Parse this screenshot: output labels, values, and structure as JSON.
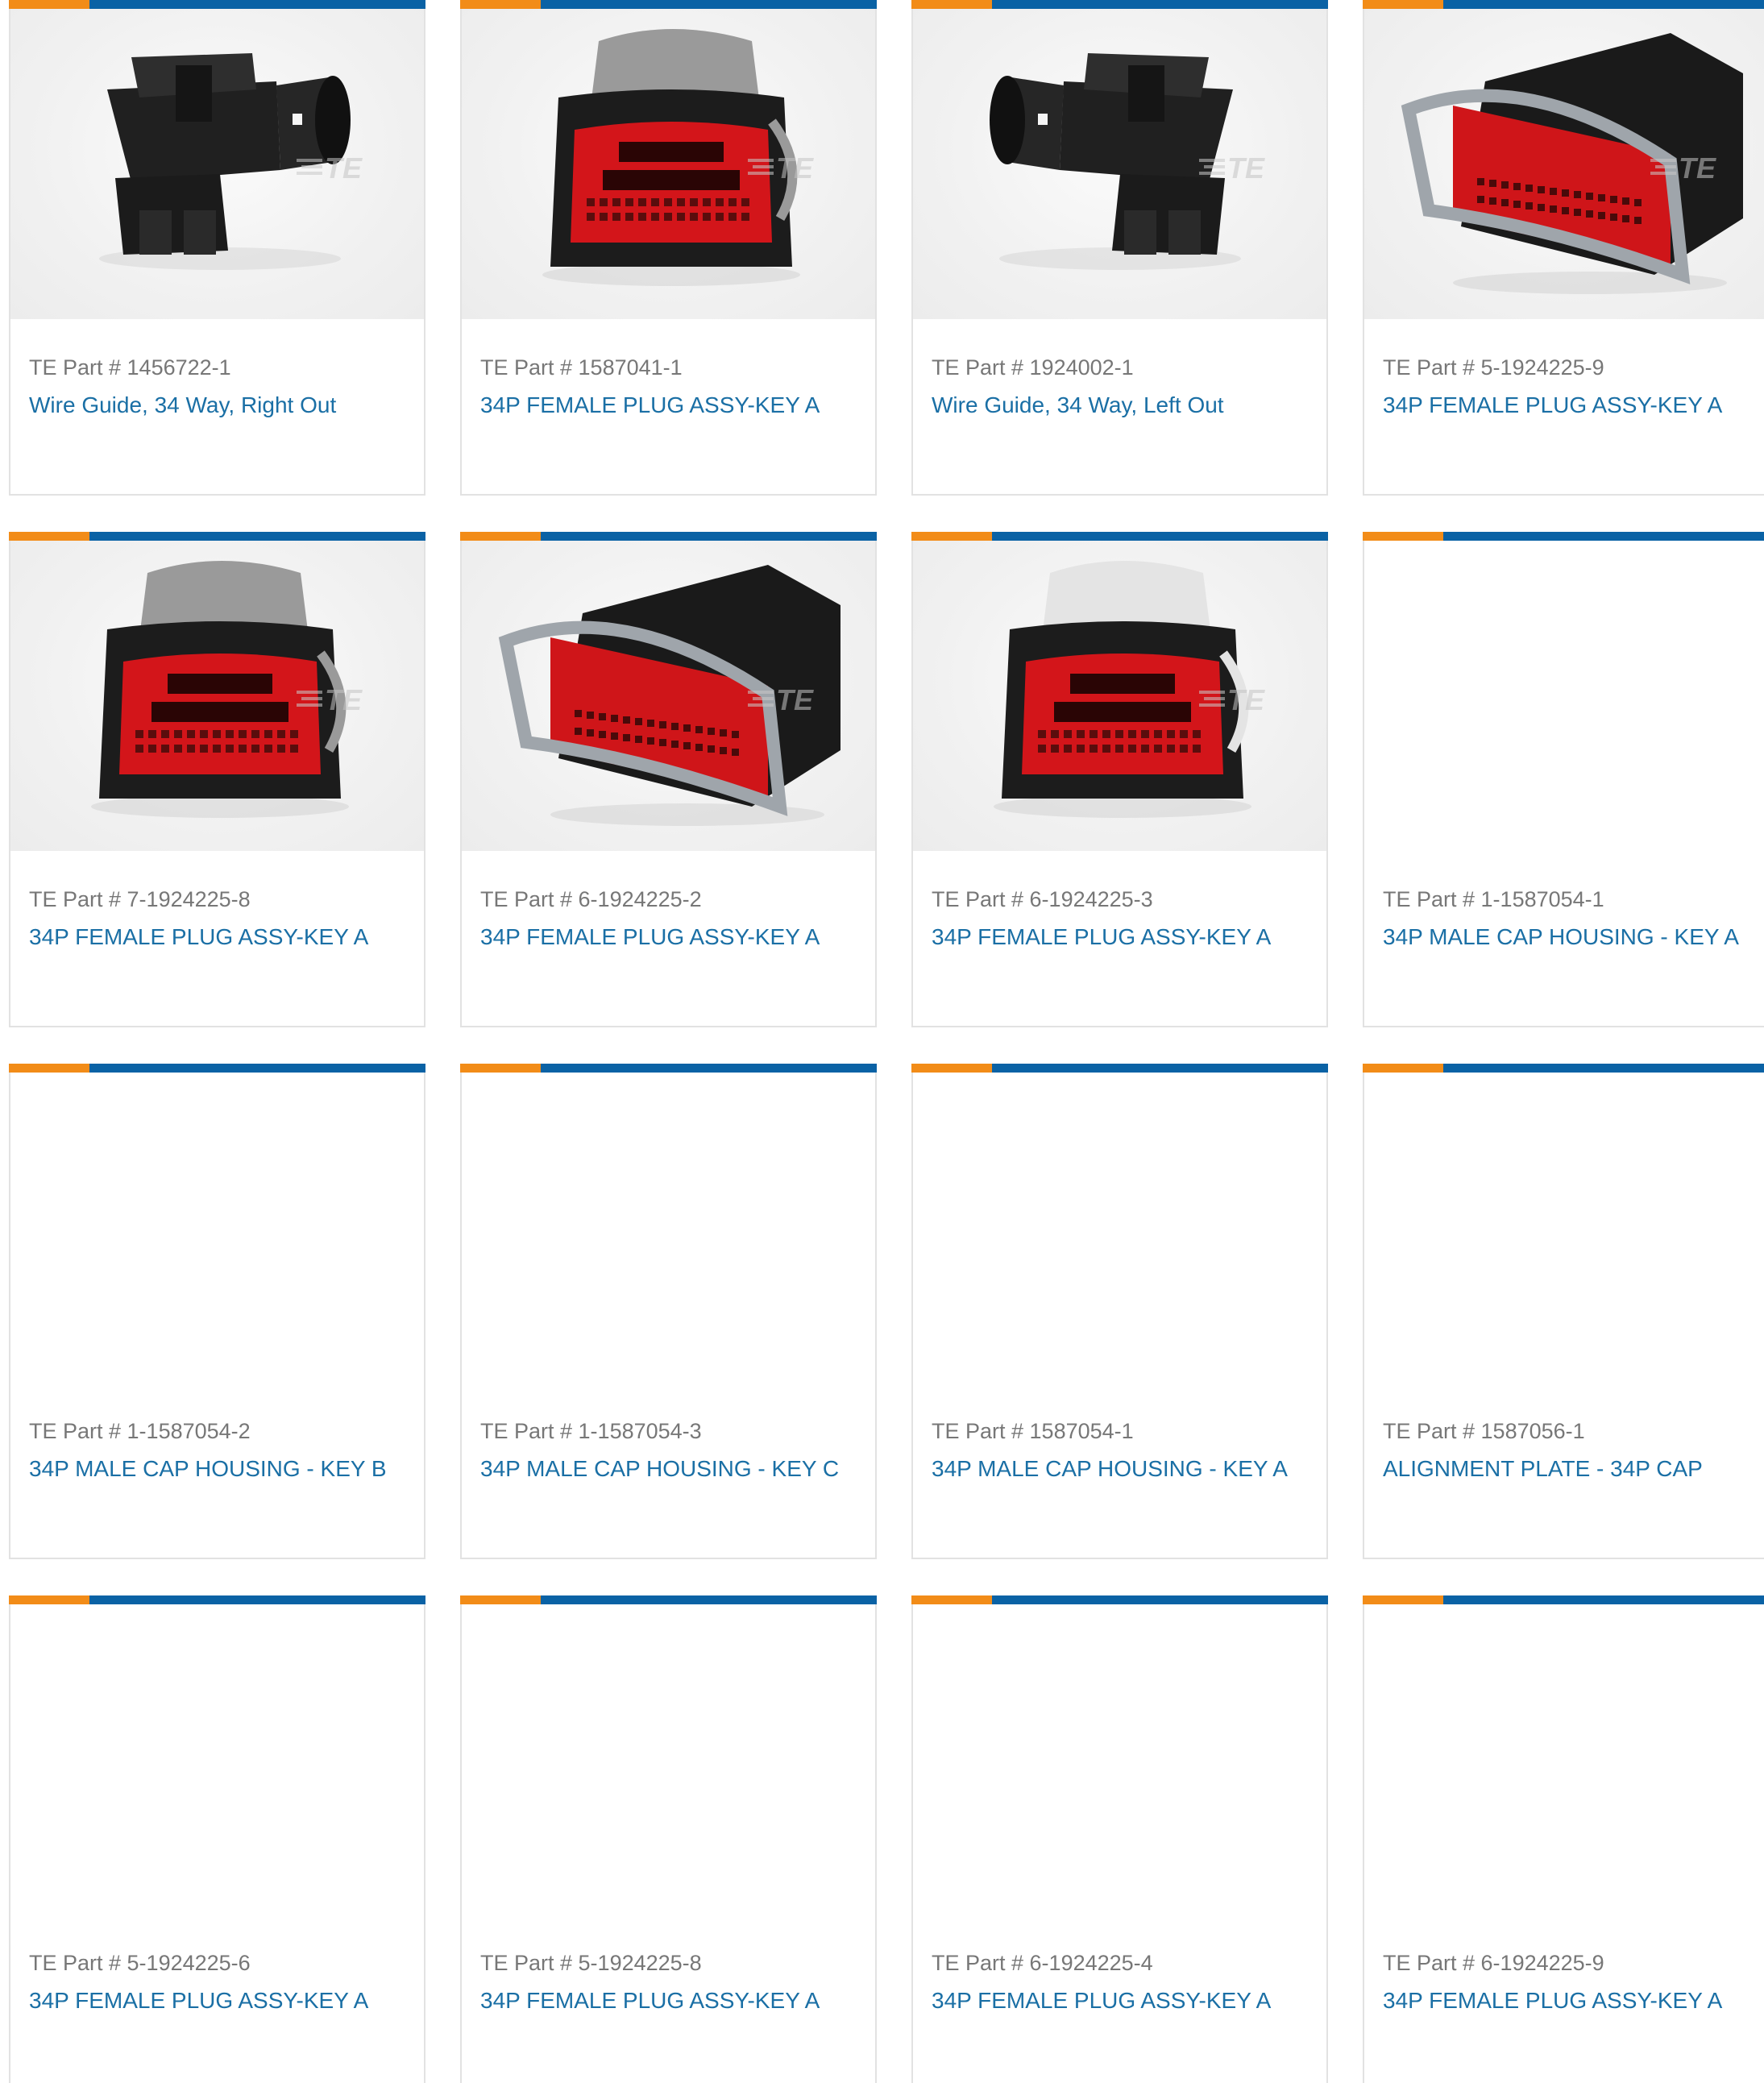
{
  "colors": {
    "accent_orange": "#f28c18",
    "accent_blue": "#0a62a5",
    "link": "#1a6fa5",
    "muted_text": "#777777",
    "card_border": "#e2e2e2"
  },
  "watermark": "TE",
  "products": [
    {
      "part": "TE Part # 1456722-1",
      "name": "Wire Guide, 34 Way, Right Out",
      "image": "wire-guide-right"
    },
    {
      "part": "TE Part # 1587041-1",
      "name": "34P FEMALE PLUG ASSY-KEY A",
      "image": "female-plug-front"
    },
    {
      "part": "TE Part # 1924002-1",
      "name": "Wire Guide, 34 Way, Left Out",
      "image": "wire-guide-left"
    },
    {
      "part": "TE Part # 5-1924225-9",
      "name": "34P FEMALE PLUG ASSY-KEY A",
      "image": "female-plug-angled"
    },
    {
      "part": "TE Part # 7-1924225-8",
      "name": "34P FEMALE PLUG ASSY-KEY A",
      "image": "female-plug-front"
    },
    {
      "part": "TE Part # 6-1924225-2",
      "name": "34P FEMALE PLUG ASSY-KEY A",
      "image": "female-plug-angled"
    },
    {
      "part": "TE Part # 6-1924225-3",
      "name": "34P FEMALE PLUG ASSY-KEY A",
      "image": "female-plug-front-white"
    },
    {
      "part": "TE Part # 1-1587054-1",
      "name": "34P MALE CAP HOUSING - KEY A",
      "image": ""
    },
    {
      "part": "TE Part # 1-1587054-2",
      "name": "34P MALE CAP HOUSING - KEY B",
      "image": ""
    },
    {
      "part": "TE Part # 1-1587054-3",
      "name": "34P MALE CAP HOUSING - KEY C",
      "image": ""
    },
    {
      "part": "TE Part # 1587054-1",
      "name": "34P MALE CAP HOUSING - KEY A",
      "image": ""
    },
    {
      "part": "TE Part # 1587056-1",
      "name": "ALIGNMENT PLATE - 34P CAP",
      "image": ""
    },
    {
      "part": "TE Part # 5-1924225-6",
      "name": "34P FEMALE PLUG ASSY-KEY A",
      "image": ""
    },
    {
      "part": "TE Part # 5-1924225-8",
      "name": "34P FEMALE PLUG ASSY-KEY A",
      "image": ""
    },
    {
      "part": "TE Part # 6-1924225-4",
      "name": "34P FEMALE PLUG ASSY-KEY A",
      "image": ""
    },
    {
      "part": "TE Part # 6-1924225-9",
      "name": "34P FEMALE PLUG ASSY-KEY A",
      "image": ""
    }
  ]
}
